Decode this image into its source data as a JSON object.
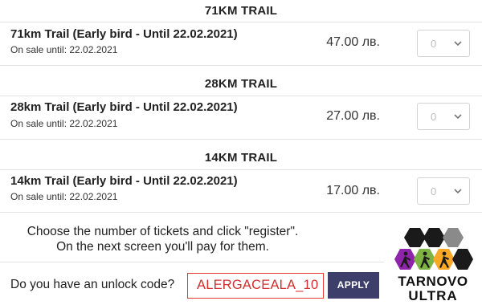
{
  "sections": [
    {
      "title": "71KM TRAIL",
      "ticket": {
        "name": "71km Trail (Early bird - Until 22.02.2021)",
        "sale_info": "On sale until: 22.02.2021",
        "price": "47.00 лв.",
        "quantity": "0"
      }
    },
    {
      "title": "28KM TRAIL",
      "ticket": {
        "name": "28km Trail (Early bird - Until 22.02.2021)",
        "sale_info": "On sale until: 22.02.2021",
        "price": "27.00 лв.",
        "quantity": "0"
      }
    },
    {
      "title": "14KM TRAIL",
      "ticket": {
        "name": "14km Trail (Early bird - Until 22.02.2021)",
        "sale_info": "On sale until: 22.02.2021",
        "price": "17.00 лв.",
        "quantity": "0"
      }
    }
  ],
  "info": {
    "line1": "Choose the number of tickets and click \"register\".",
    "line2": "On the next screen you'll pay for  them."
  },
  "unlock": {
    "label": "Do you have an unlock code?",
    "code_value": "ALERGACEALA_10",
    "apply_label": "APPLY"
  },
  "logo": {
    "line1": "TARNOVO",
    "line2": "ULTRA"
  },
  "colors": {
    "apply_button": "#3e3e6b",
    "code_border": "#e53935",
    "logo_black": "#1a1a1a",
    "logo_grey": "#8a8a8a",
    "logo_purple": "#8e24aa",
    "logo_green": "#7cb342",
    "logo_yellow": "#f9a825"
  },
  "icons": [
    "chevron-down-icon",
    "tarnovo-ultra-logo"
  ]
}
